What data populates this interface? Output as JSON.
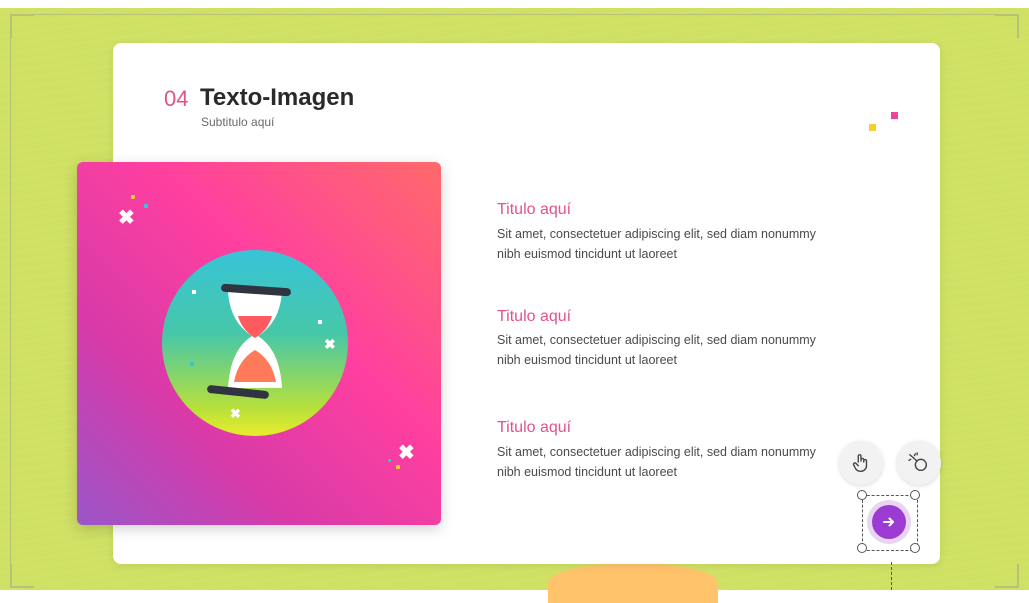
{
  "slide": {
    "number": "04",
    "title": "Texto-Imagen",
    "subtitle": "Subtitulo aquí"
  },
  "items": [
    {
      "title": "Titulo aquí",
      "text": "Sit amet, consectetuer adipiscing elit, sed diam nonummy nibh euismod tincidunt ut laoreet"
    },
    {
      "title": "Titulo aquí",
      "text": "Sit amet, consectetuer adipiscing elit, sed diam nonummy nibh euismod tincidunt ut laoreet"
    },
    {
      "title": "Titulo aquí",
      "text": "Sit amet, consectetuer adipiscing elit, sed diam nonummy nibh euismod tincidunt ut laoreet"
    }
  ],
  "toolbar": {
    "interaction_icon": "hand-pointer-icon",
    "animation_icon": "magic-wand-icon",
    "next_icon": "arrow-right-icon"
  },
  "colors": {
    "canvas": "#cfe063",
    "accent_pink": "#e2528d",
    "next_button": "#9c3bd3"
  }
}
